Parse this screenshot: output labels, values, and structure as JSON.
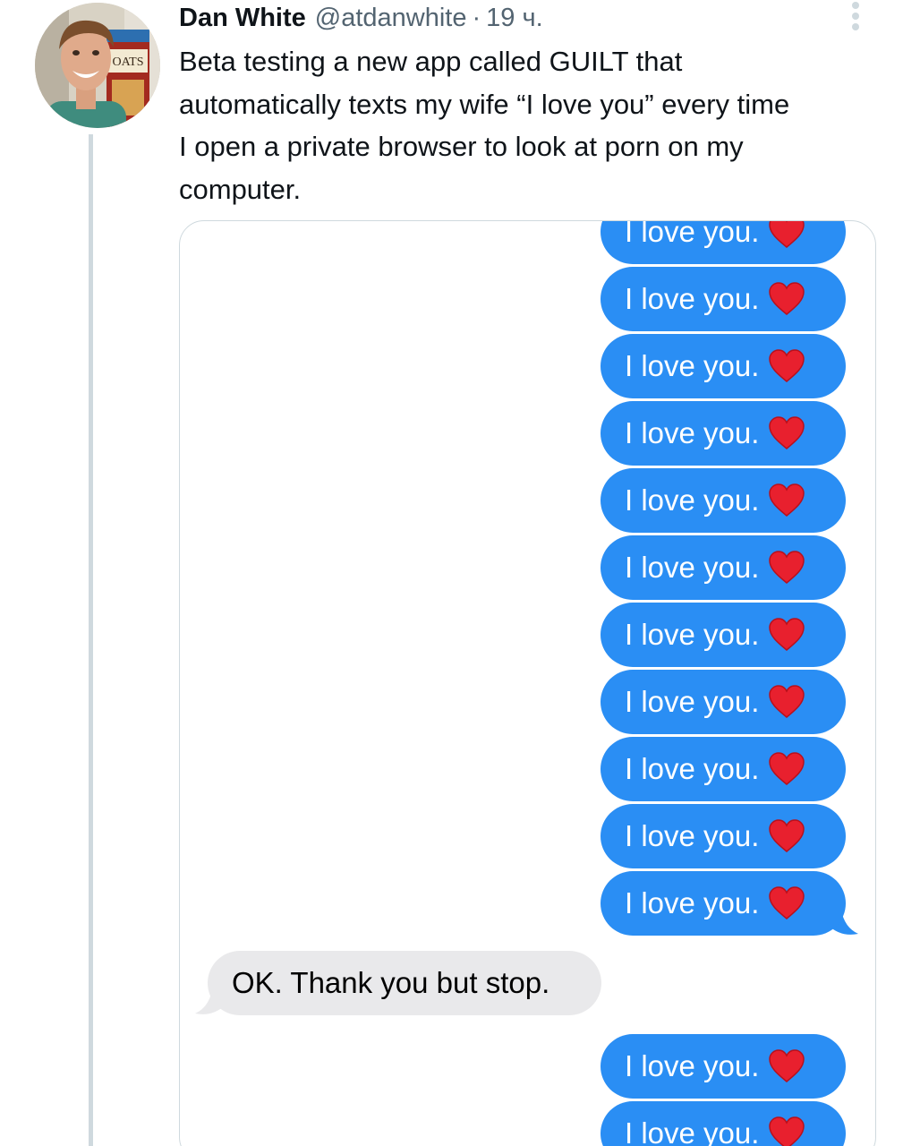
{
  "tweet": {
    "author_name": "Dan White",
    "author_handle": "@atdanwhite",
    "separator": "·",
    "timestamp": "19 ч.",
    "avatar_text": "OATS",
    "more_icon": "more-vertical-icon",
    "body_lines": [
      "Beta testing a new app called GUILT that",
      "automatically texts my wife “I love you” every time",
      "I open a private browser to look at porn on my",
      "computer."
    ]
  },
  "screenshot": {
    "sent_bubble_color": "#2a8ef4",
    "received_bubble_color": "#e9e9eb",
    "heart_icon": "red-heart-icon",
    "messages": [
      {
        "direction": "sent",
        "text": "I love you."
      },
      {
        "direction": "sent",
        "text": "I love you."
      },
      {
        "direction": "sent",
        "text": "I love you."
      },
      {
        "direction": "sent",
        "text": "I love you."
      },
      {
        "direction": "sent",
        "text": "I love you."
      },
      {
        "direction": "sent",
        "text": "I love you."
      },
      {
        "direction": "sent",
        "text": "I love you."
      },
      {
        "direction": "sent",
        "text": "I love you."
      },
      {
        "direction": "sent",
        "text": "I love you."
      },
      {
        "direction": "sent",
        "text": "I love you."
      },
      {
        "direction": "sent",
        "text": "I love you."
      },
      {
        "direction": "received",
        "text": "OK. Thank you but stop."
      },
      {
        "direction": "sent",
        "text": "I love you."
      },
      {
        "direction": "sent",
        "text": "I love you."
      }
    ]
  }
}
